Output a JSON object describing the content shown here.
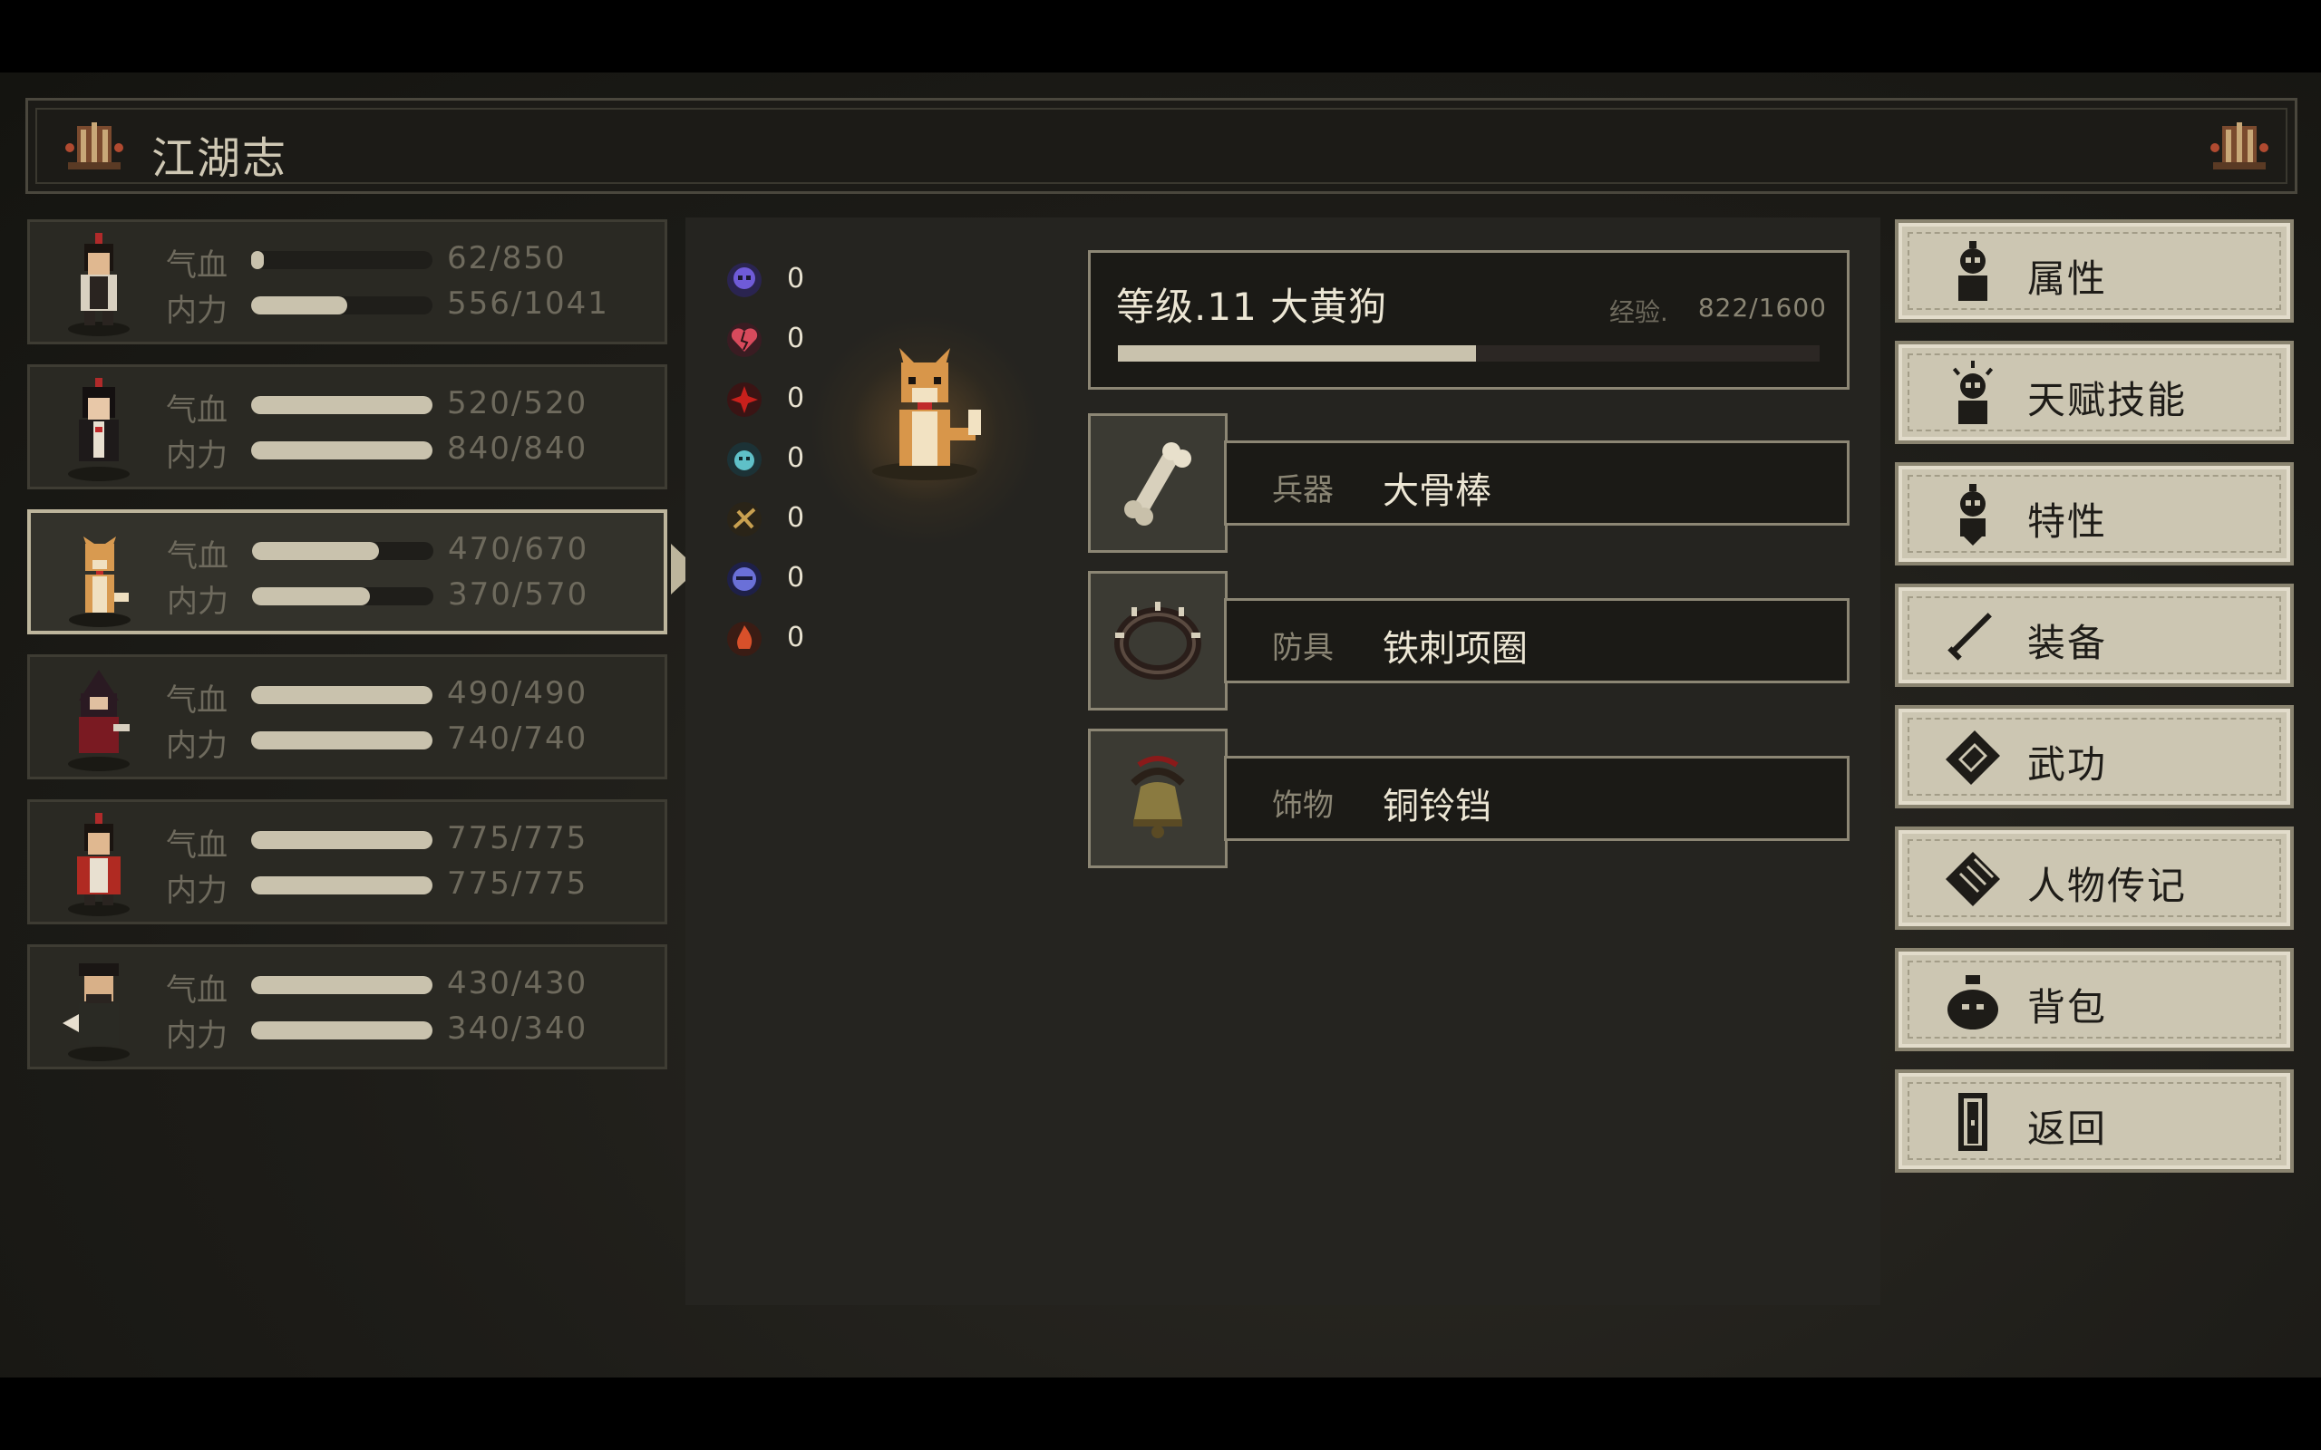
{
  "title": "江湖志",
  "party": [
    {
      "hp_label": "气血",
      "hp_value": "62/850",
      "hp_fraction": 0.07,
      "mp_label": "内力",
      "mp_value": "556/1041",
      "mp_fraction": 0.53
    },
    {
      "hp_label": "气血",
      "hp_value": "520/520",
      "hp_fraction": 1.0,
      "mp_label": "内力",
      "mp_value": "840/840",
      "mp_fraction": 1.0
    },
    {
      "hp_label": "气血",
      "hp_value": "470/670",
      "hp_fraction": 0.7,
      "mp_label": "内力",
      "mp_value": "370/570",
      "mp_fraction": 0.65
    },
    {
      "hp_label": "气血",
      "hp_value": "490/490",
      "hp_fraction": 1.0,
      "mp_label": "内力",
      "mp_value": "740/740",
      "mp_fraction": 1.0
    },
    {
      "hp_label": "气血",
      "hp_value": "775/775",
      "hp_fraction": 1.0,
      "mp_label": "内力",
      "mp_value": "775/775",
      "mp_fraction": 1.0
    },
    {
      "hp_label": "气血",
      "hp_value": "430/430",
      "hp_fraction": 1.0,
      "mp_label": "内力",
      "mp_value": "340/340",
      "mp_fraction": 1.0
    }
  ],
  "resistances": [
    {
      "icon": "skull-icon",
      "value": "0",
      "color": "#6f5bd8"
    },
    {
      "icon": "broken-heart-icon",
      "value": "0",
      "color": "#d84a5c"
    },
    {
      "icon": "spark-icon",
      "value": "0",
      "color": "#c8201c"
    },
    {
      "icon": "spirit-icon",
      "value": "0",
      "color": "#5fc0c8"
    },
    {
      "icon": "whirl-icon",
      "value": "0",
      "color": "#c8a050"
    },
    {
      "icon": "face-icon",
      "value": "0",
      "color": "#6a70d8"
    },
    {
      "icon": "flame-icon",
      "value": "0",
      "color": "#d8502a"
    }
  ],
  "character": {
    "level_text": "等级.11 大黄狗",
    "exp_label": "经验.",
    "exp_value": "822/1600",
    "exp_fraction": 0.51
  },
  "equipment": [
    {
      "slot": "兵器",
      "name": "大骨棒",
      "icon": "bone-icon"
    },
    {
      "slot": "防具",
      "name": "铁刺项圈",
      "icon": "spiked-collar-icon"
    },
    {
      "slot": "饰物",
      "name": "铜铃铛",
      "icon": "bell-icon"
    }
  ],
  "menu": [
    {
      "label": "属性",
      "icon": "person-icon"
    },
    {
      "label": "天赋技能",
      "icon": "talent-icon"
    },
    {
      "label": "特性",
      "icon": "trait-icon"
    },
    {
      "label": "装备",
      "icon": "sword-icon"
    },
    {
      "label": "武功",
      "icon": "book-icon"
    },
    {
      "label": "人物传记",
      "icon": "scroll-icon"
    },
    {
      "label": "背包",
      "icon": "bag-icon"
    },
    {
      "label": "返回",
      "icon": "door-icon"
    }
  ]
}
